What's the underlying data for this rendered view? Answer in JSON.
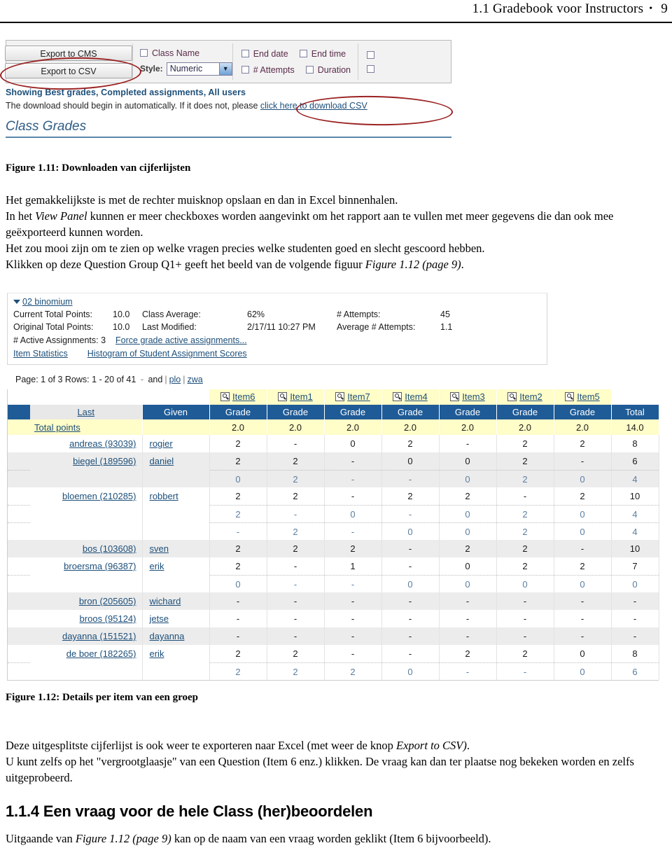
{
  "header": {
    "section": "1.1 Gradebook voor Instructors",
    "bullet": "•",
    "page_number": "9"
  },
  "figure_1_11": {
    "buttons": {
      "export_cms": "Export to CMS",
      "export_csv": "Export to CSV"
    },
    "class_name_checkbox_label": "Class Name",
    "style_label": "Style:",
    "style_value": "Numeric",
    "checkboxes": [
      "End date",
      "End time",
      "# Attempts",
      "Duration"
    ],
    "showing_line": "Showing Best grades, Completed assignments, All users",
    "download_text": "The download should begin in automatically. If it does not, please ",
    "download_link": "click here to download CSV",
    "class_grades_heading": "Class Grades",
    "caption": "Figure 1.11: Downloaden van cijferlijsten"
  },
  "body": {
    "p1": "Het gemakkelijkste is met de rechter muisknop opslaan en dan in Excel binnenhalen.",
    "p2_a": "In het ",
    "p2_i": "View Panel",
    "p2_b": " kunnen er meer checkboxes worden aangevinkt om het rapport aan te vullen met meer gegevens die dan ook mee geëxporteerd kunnen worden.",
    "p3": "Het zou mooi zijn om te zien op welke vragen precies welke studenten goed en slecht gescoord hebben.",
    "p4_a": "Klikken op deze Question Group Q1+ geeft het beeld van de volgende figuur ",
    "p4_i": "Figure 1.12 (page 9)",
    "p4_b": ".",
    "p5_a": "Deze uitgesplitste cijferlijst is ook weer te exporteren naar Excel (met weer de knop ",
    "p5_i": "Export to CSV)",
    "p5_b": ".",
    "p6": "U kunt zelfs op het \"vergrootglaasje\" van een Question (Item 6 enz.) klikken. De vraag kan dan ter plaatse nog bekeken worden en zelfs uitgeprobeerd.",
    "h3": "1.1.4 Een vraag voor de hele Class (her)beoordelen",
    "p7_a": "Uitgaande van ",
    "p7_i": "Figure 1.12 (page 9)",
    "p7_b": " kan op de naam van een vraag worden geklikt (Item 6 bijvoorbeeld)."
  },
  "figure_1_12": {
    "caption": "Figure 1.12: Details per item van een groep",
    "group_name": "02 binomium",
    "stats": {
      "current_total_points_label": "Current Total Points:",
      "current_total_points_value": "10.0",
      "class_average_label": "Class Average:",
      "class_average_value": "62%",
      "attempts_label": "# Attempts:",
      "attempts_value": "45",
      "original_total_points_label": "Original Total Points:",
      "original_total_points_value": "10.0",
      "last_modified_label": "Last Modified:",
      "last_modified_value": "2/17/11 10:27 PM",
      "average_attempts_label": "Average # Attempts:",
      "average_attempts_value": "1.1",
      "active_assignments_label": "# Active Assignments:",
      "active_assignments_value": "3",
      "force_grade_link": "Force grade active assignments...",
      "item_statistics_link": "Item Statistics",
      "histogram_link": "Histogram of Student Assignment Scores"
    },
    "pager": {
      "text": "Page: 1 of 3 Rows: 1 - 20 of 41",
      "dash": "-",
      "and": "and",
      "link1": "plo",
      "link2": "zwa"
    },
    "table": {
      "item_headers": [
        "Item6",
        "Item1",
        "Item7",
        "Item4",
        "Item3",
        "Item2",
        "Item5"
      ],
      "col_last": "Last",
      "col_given": "Given",
      "col_grade": "Grade",
      "col_total": "Total",
      "total_points_label": "Total points",
      "total_points_values": [
        "2.0",
        "2.0",
        "2.0",
        "2.0",
        "2.0",
        "2.0",
        "2.0"
      ],
      "total_points_total": "14.0",
      "rows": [
        {
          "surname": "andreas (93039)",
          "given": "rogier",
          "alt": false,
          "grades": [
            "2",
            "-",
            "0",
            "2",
            "-",
            "2",
            "2"
          ],
          "total": "8",
          "sub": []
        },
        {
          "surname": "biegel (189596)",
          "given": "daniel",
          "alt": true,
          "grades": [
            "2",
            "2",
            "-",
            "0",
            "0",
            "2",
            "-"
          ],
          "total": "6",
          "sub": [
            {
              "grades": [
                "0",
                "2",
                "-",
                "-",
                "0",
                "2",
                "0"
              ],
              "total": "4"
            }
          ]
        },
        {
          "surname": "bloemen (210285)",
          "given": "robbert",
          "alt": false,
          "grades": [
            "2",
            "2",
            "-",
            "2",
            "2",
            "-",
            "2"
          ],
          "total": "10",
          "sub": [
            {
              "grades": [
                "2",
                "-",
                "0",
                "-",
                "0",
                "2",
                "0"
              ],
              "total": "4"
            },
            {
              "grades": [
                "-",
                "2",
                "-",
                "0",
                "0",
                "2",
                "0"
              ],
              "total": "4"
            }
          ]
        },
        {
          "surname": "bos (103608)",
          "given": "sven",
          "alt": true,
          "grades": [
            "2",
            "2",
            "2",
            "-",
            "2",
            "2",
            "-"
          ],
          "total": "10",
          "sub": []
        },
        {
          "surname": "broersma (96387)",
          "given": "erik",
          "alt": false,
          "grades": [
            "2",
            "-",
            "1",
            "-",
            "0",
            "2",
            "2"
          ],
          "total": "7",
          "sub": [
            {
              "grades": [
                "0",
                "-",
                "-",
                "0",
                "0",
                "0",
                "0"
              ],
              "total": "0"
            }
          ]
        },
        {
          "surname": "bron (205605)",
          "given": "wichard",
          "alt": true,
          "grades": [
            "-",
            "-",
            "-",
            "-",
            "-",
            "-",
            "-"
          ],
          "total": "-",
          "sub": []
        },
        {
          "surname": "broos (95124)",
          "given": "jetse",
          "alt": false,
          "grades": [
            "-",
            "-",
            "-",
            "-",
            "-",
            "-",
            "-"
          ],
          "total": "-",
          "sub": []
        },
        {
          "surname": "dayanna (151521)",
          "given": "dayanna",
          "alt": true,
          "grades": [
            "-",
            "-",
            "-",
            "-",
            "-",
            "-",
            "-"
          ],
          "total": "-",
          "sub": []
        },
        {
          "surname": "de boer (182265)",
          "given": "erik",
          "alt": false,
          "grades": [
            "2",
            "2",
            "-",
            "-",
            "2",
            "2",
            "0"
          ],
          "total": "8",
          "sub": [
            {
              "grades": [
                "2",
                "2",
                "2",
                "0",
                "-",
                "-",
                "0"
              ],
              "total": "6"
            }
          ]
        }
      ]
    }
  },
  "colors": {
    "annotation_red": "#9b2222",
    "header_blue": "#1f5b96",
    "link_blue": "#1d4f7a",
    "highlight_yellow": "#fffdc8"
  }
}
